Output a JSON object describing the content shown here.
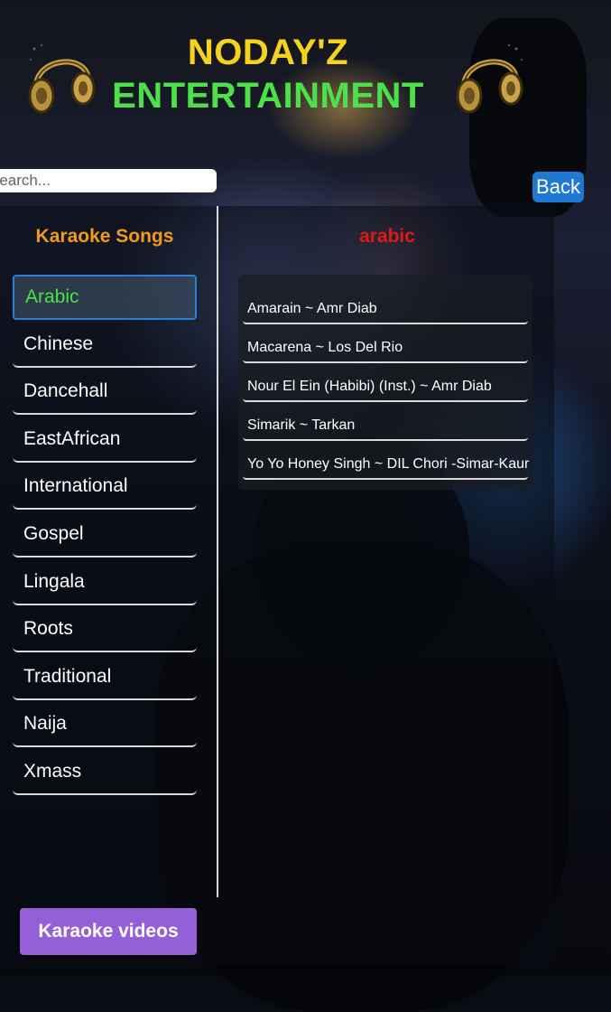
{
  "header": {
    "title_line1": "NODAY'Z",
    "title_line2": "ENTERTAINMENT",
    "title_line1_color": "#f5d21f",
    "title_line2_color": "#4de04a"
  },
  "search": {
    "placeholder": "Search..."
  },
  "back_label": "Back",
  "sidebar": {
    "title": "Karaoke Songs",
    "categories": [
      "Arabic",
      "Chinese",
      "Dancehall",
      "EastAfrican",
      "International",
      "Gospel",
      "Lingala",
      "Roots",
      "Traditional",
      "Naija",
      "Xmass"
    ],
    "selected": "Arabic"
  },
  "content": {
    "title": "arabic",
    "songs": [
      "Amarain ~ Amr Diab",
      "Macarena ~ Los Del Rio",
      "Nour El Ein (Habibi) (Inst.) ~ Amr Diab",
      "Simarik ~ Tarkan",
      "Yo Yo Honey Singh ~ DIL Chori -Simar-Kaur"
    ]
  },
  "videos_button_label": "Karaoke videos",
  "icons": {
    "logo": "headphones-icon"
  },
  "colors": {
    "accent_orange": "#f29a1b",
    "category_title_red": "#e01818",
    "active_green": "#4ae04a",
    "back_blue": "#1f78d1",
    "videos_purple": "#9460d8"
  }
}
